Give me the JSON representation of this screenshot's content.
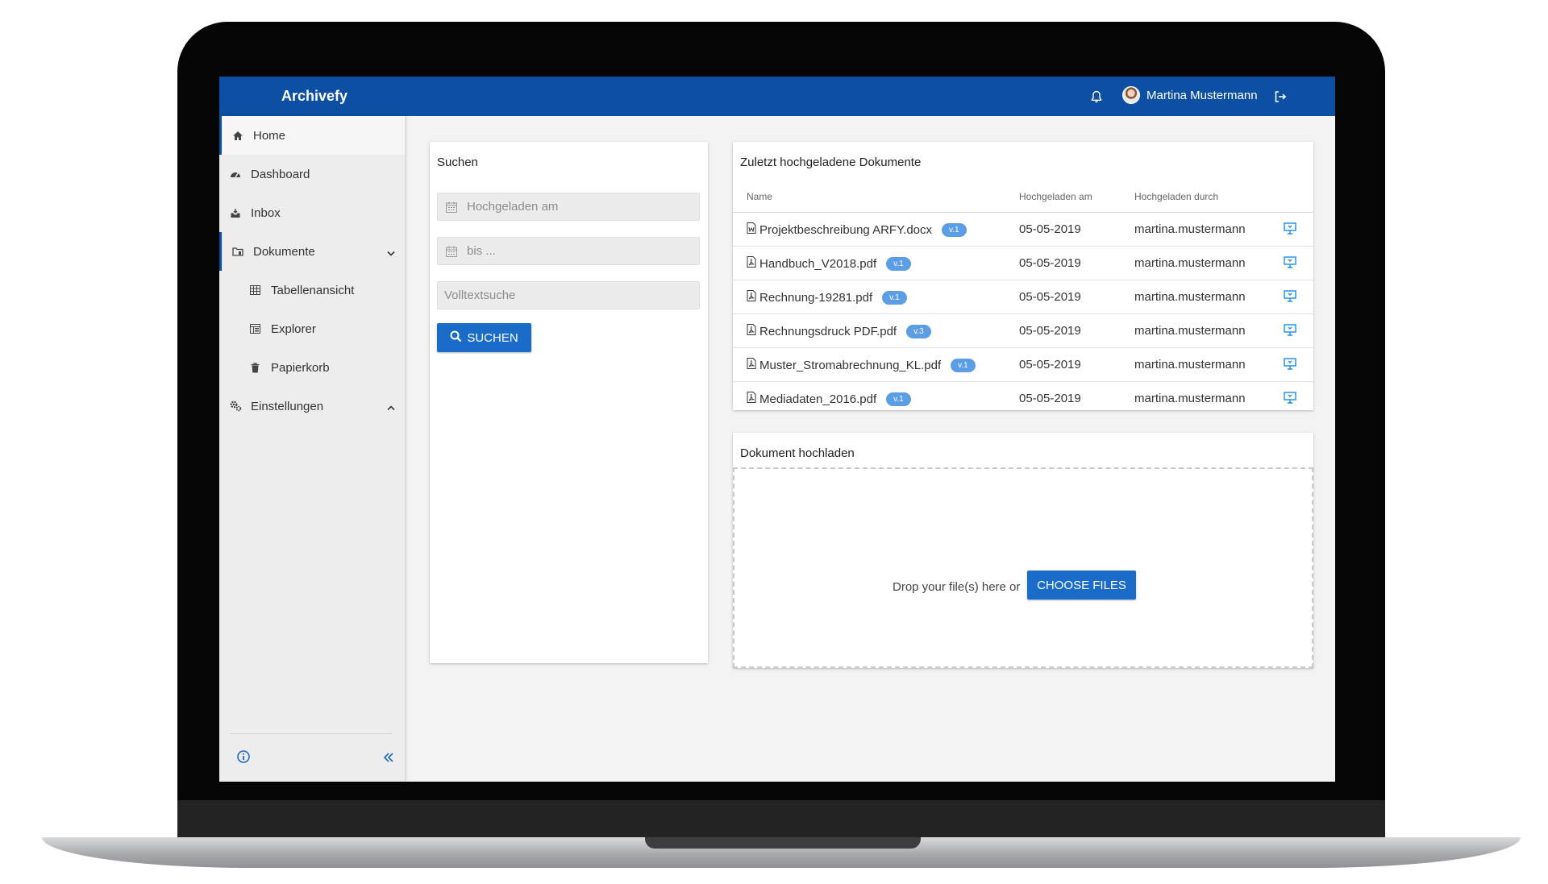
{
  "app": {
    "title": "Archivefy"
  },
  "header": {
    "user_name": "Martina Mustermann"
  },
  "sidebar": {
    "items": [
      {
        "label": "Home",
        "icon": "home-icon"
      },
      {
        "label": "Dashboard",
        "icon": "dashboard-icon"
      },
      {
        "label": "Inbox",
        "icon": "inbox-icon"
      },
      {
        "label": "Dokumente",
        "icon": "documents-icon"
      },
      {
        "label": "Tabellenansicht",
        "icon": "table-icon"
      },
      {
        "label": "Explorer",
        "icon": "explorer-icon"
      },
      {
        "label": "Papierkorb",
        "icon": "trash-icon"
      },
      {
        "label": "Einstellungen",
        "icon": "settings-icon"
      }
    ]
  },
  "search": {
    "title": "Suchen",
    "from_placeholder": "Hochgeladen am",
    "to_placeholder": "bis ...",
    "fulltext_placeholder": "Volltextsuche",
    "button_label": "SUCHEN"
  },
  "recent": {
    "title": "Zuletzt hochgeladene Dokumente",
    "columns": [
      "Name",
      "Hochgeladen am",
      "Hochgeladen durch"
    ],
    "rows": [
      {
        "name": "Projektbeschreibung ARFY.docx",
        "version": "v.1",
        "date": "05-05-2019",
        "user": "martina.mustermann"
      },
      {
        "name": "Handbuch_V2018.pdf",
        "version": "v.1",
        "date": "05-05-2019",
        "user": "martina.mustermann"
      },
      {
        "name": "Rechnung-19281.pdf",
        "version": "v.1",
        "date": "05-05-2019",
        "user": "martina.mustermann"
      },
      {
        "name": "Rechnungsdruck PDF.pdf",
        "version": "v.3",
        "date": "05-05-2019",
        "user": "martina.mustermann"
      },
      {
        "name": "Muster_Stromabrechnung_KL.pdf",
        "version": "v.1",
        "date": "05-05-2019",
        "user": "martina.mustermann"
      },
      {
        "name": "Mediadaten_2016.pdf",
        "version": "v.1",
        "date": "05-05-2019",
        "user": "martina.mustermann"
      }
    ]
  },
  "upload": {
    "title": "Dokument hochladen",
    "drop_text": "Drop your file(s) here or",
    "button_label": "CHOOSE FILES"
  },
  "colors": {
    "brand": "#0d4fa3",
    "button": "#1a6cc8",
    "badge": "#5b9ee6"
  }
}
